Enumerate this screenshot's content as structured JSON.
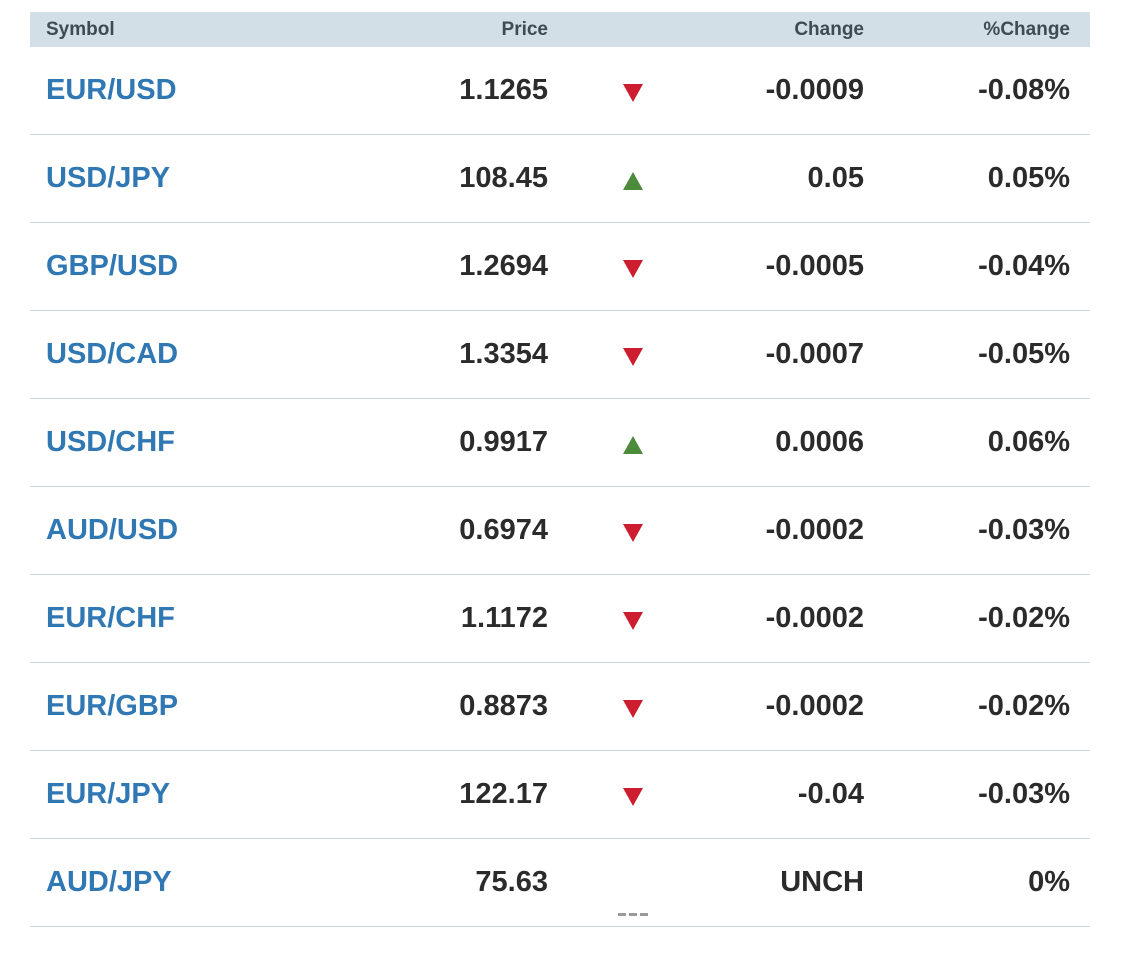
{
  "header": {
    "symbol": "Symbol",
    "price": "Price",
    "change": "Change",
    "pct_change": "%Change"
  },
  "colors": {
    "header_bg": "#d3dfe6",
    "symbol_link": "#2f78b3",
    "down_arrow": "#cc1e2e",
    "up_arrow": "#4b8b3b",
    "row_border": "#cad5dc"
  },
  "rows": [
    {
      "symbol": "EUR/USD",
      "price": "1.1265",
      "direction": "down",
      "change": "-0.0009",
      "pct": "-0.08%"
    },
    {
      "symbol": "USD/JPY",
      "price": "108.45",
      "direction": "up",
      "change": "0.05",
      "pct": "0.05%"
    },
    {
      "symbol": "GBP/USD",
      "price": "1.2694",
      "direction": "down",
      "change": "-0.0005",
      "pct": "-0.04%"
    },
    {
      "symbol": "USD/CAD",
      "price": "1.3354",
      "direction": "down",
      "change": "-0.0007",
      "pct": "-0.05%"
    },
    {
      "symbol": "USD/CHF",
      "price": "0.9917",
      "direction": "up",
      "change": "0.0006",
      "pct": "0.06%"
    },
    {
      "symbol": "AUD/USD",
      "price": "0.6974",
      "direction": "down",
      "change": "-0.0002",
      "pct": "-0.03%"
    },
    {
      "symbol": "EUR/CHF",
      "price": "1.1172",
      "direction": "down",
      "change": "-0.0002",
      "pct": "-0.02%"
    },
    {
      "symbol": "EUR/GBP",
      "price": "0.8873",
      "direction": "down",
      "change": "-0.0002",
      "pct": "-0.02%"
    },
    {
      "symbol": "EUR/JPY",
      "price": "122.17",
      "direction": "down",
      "change": "-0.04",
      "pct": "-0.03%"
    },
    {
      "symbol": "AUD/JPY",
      "price": "75.63",
      "direction": "unchanged",
      "change": "UNCH",
      "pct": "0%"
    }
  ]
}
